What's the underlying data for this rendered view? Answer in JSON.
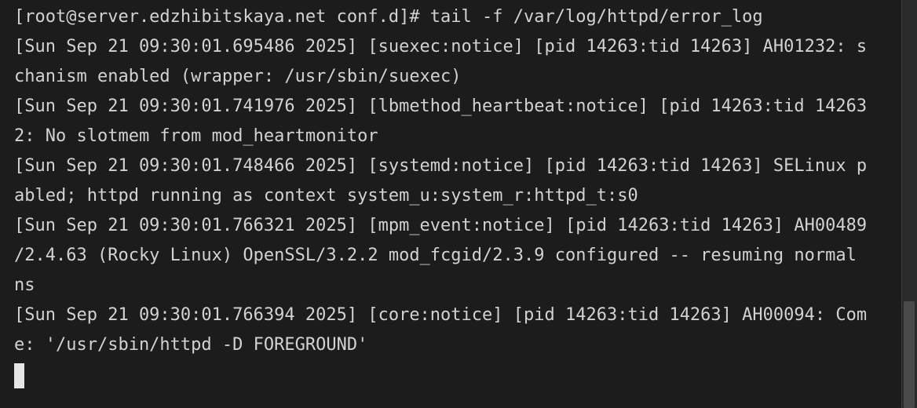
{
  "terminal": {
    "lines": [
      "[root@server.edzhibitskaya.net conf.d]# tail -f /var/log/httpd/error_log",
      "[Sun Sep 21 09:30:01.695486 2025] [suexec:notice] [pid 14263:tid 14263] AH01232: s",
      "chanism enabled (wrapper: /usr/sbin/suexec)",
      "[Sun Sep 21 09:30:01.741976 2025] [lbmethod_heartbeat:notice] [pid 14263:tid 14263",
      "2: No slotmem from mod_heartmonitor",
      "[Sun Sep 21 09:30:01.748466 2025] [systemd:notice] [pid 14263:tid 14263] SELinux p",
      "abled; httpd running as context system_u:system_r:httpd_t:s0",
      "[Sun Sep 21 09:30:01.766321 2025] [mpm_event:notice] [pid 14263:tid 14263] AH00489",
      "/2.4.63 (Rocky Linux) OpenSSL/3.2.2 mod_fcgid/2.3.9 configured -- resuming normal",
      "ns",
      "[Sun Sep 21 09:30:01.766394 2025] [core:notice] [pid 14263:tid 14263] AH00094: Com",
      "e: '/usr/sbin/httpd -D FOREGROUND'"
    ]
  },
  "colors": {
    "background": "#1c1c1c",
    "text": "#d2d2d2",
    "cursor": "#e6e6e6"
  }
}
